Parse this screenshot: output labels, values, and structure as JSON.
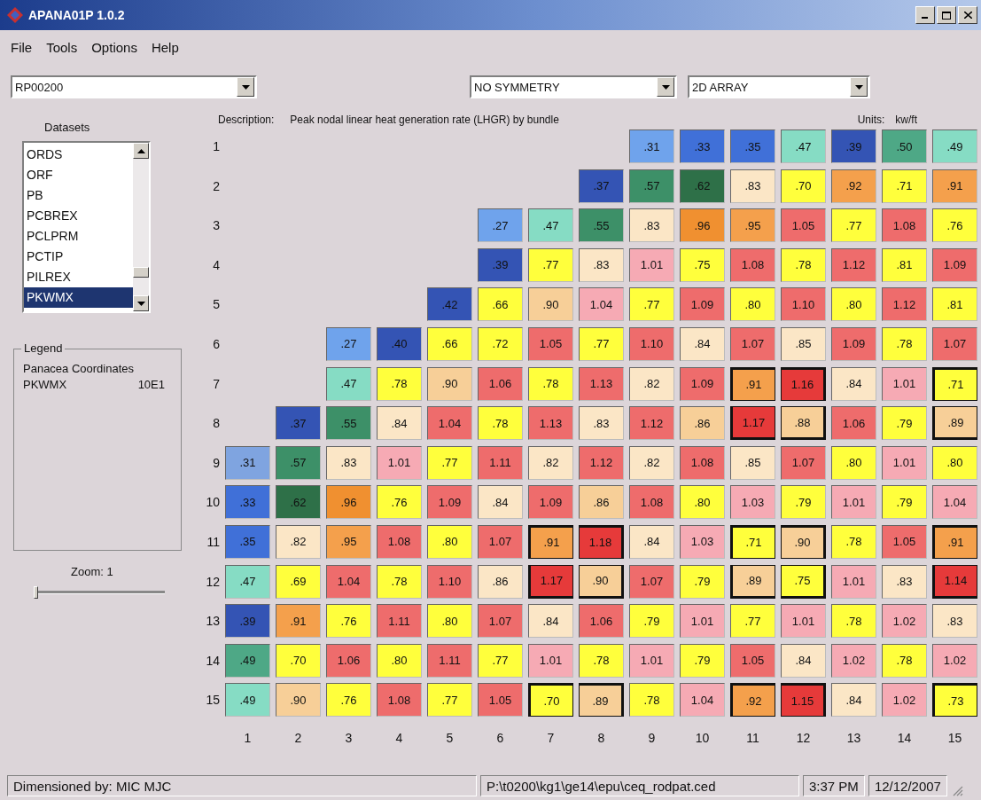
{
  "window": {
    "title": "APANA01P 1.0.2"
  },
  "menu": [
    {
      "label": "File"
    },
    {
      "label": "Tools"
    },
    {
      "label": "Options"
    },
    {
      "label": "Help"
    }
  ],
  "dataset_select": {
    "value": "RP00200"
  },
  "symmetry_select": {
    "value": "NO SYMMETRY"
  },
  "view_select": {
    "value": "2D ARRAY"
  },
  "datasets": {
    "label": "Datasets",
    "items": [
      {
        "label": "ORDS",
        "selected": false
      },
      {
        "label": "ORF",
        "selected": false
      },
      {
        "label": "PB",
        "selected": false
      },
      {
        "label": "PCBREX",
        "selected": false
      },
      {
        "label": "PCLPRM",
        "selected": false
      },
      {
        "label": "PCTIP",
        "selected": false
      },
      {
        "label": "PILREX",
        "selected": false
      },
      {
        "label": "PKWMX",
        "selected": true
      }
    ]
  },
  "legend": {
    "title": "Legend",
    "heading": "Panacea Coordinates",
    "name": "PKWMX",
    "value": "10E1"
  },
  "zoom": {
    "label": "Zoom:  1",
    "level": 0
  },
  "description": {
    "label": "Description:",
    "text": "Peak nodal linear heat generation rate (LHGR) by bundle",
    "units_label": "Units:",
    "units": "kw/ft"
  },
  "grid": {
    "rows": [
      {
        "label": "1",
        "cells": [
          "",
          "",
          "",
          "",
          "",
          "",
          "",
          "",
          {
            "value": ".31",
            "color": "#6fa3ec",
            "boxed": false
          },
          {
            "value": ".33",
            "color": "#4070d8",
            "boxed": false
          },
          {
            "value": ".35",
            "color": "#4070d8",
            "boxed": false
          },
          {
            "value": ".47",
            "color": "#86dcc4",
            "boxed": false
          },
          {
            "value": ".39",
            "color": "#3454b4",
            "boxed": false
          },
          {
            "value": ".50",
            "color": "#4ea886",
            "boxed": false
          },
          {
            "value": ".49",
            "color": "#86dcc4",
            "boxed": false
          }
        ]
      },
      {
        "label": "2",
        "cells": [
          "",
          "",
          "",
          "",
          "",
          "",
          "",
          {
            "value": ".37",
            "color": "#3454b4",
            "boxed": false
          },
          {
            "value": ".57",
            "color": "#3d9068",
            "boxed": false
          },
          {
            "value": ".62",
            "color": "#2e7048",
            "boxed": false
          },
          {
            "value": ".83",
            "color": "#fbe6c6",
            "boxed": false
          },
          {
            "value": ".70",
            "color": "#ffff3c",
            "boxed": false
          },
          {
            "value": ".92",
            "color": "#f4a04c",
            "boxed": false
          },
          {
            "value": ".71",
            "color": "#ffff3c",
            "boxed": false
          },
          {
            "value": ".91",
            "color": "#f4a04c",
            "boxed": false
          }
        ]
      },
      {
        "label": "3",
        "cells": [
          "",
          "",
          "",
          "",
          "",
          {
            "value": ".27",
            "color": "#6fa3ec",
            "boxed": false
          },
          {
            "value": ".47",
            "color": "#86dcc4",
            "boxed": false
          },
          {
            "value": ".55",
            "color": "#3d9068",
            "boxed": false
          },
          {
            "value": ".83",
            "color": "#fbe6c6",
            "boxed": false
          },
          {
            "value": ".96",
            "color": "#f09030",
            "boxed": false
          },
          {
            "value": ".95",
            "color": "#f4a04c",
            "boxed": false
          },
          {
            "value": "1.05",
            "color": "#ee6c6c",
            "boxed": false
          },
          {
            "value": ".77",
            "color": "#ffff3c",
            "boxed": false
          },
          {
            "value": "1.08",
            "color": "#ee6c6c",
            "boxed": false
          },
          {
            "value": ".76",
            "color": "#ffff3c",
            "boxed": false
          }
        ]
      },
      {
        "label": "4",
        "cells": [
          "",
          "",
          "",
          "",
          "",
          {
            "value": ".39",
            "color": "#3454b4",
            "boxed": false
          },
          {
            "value": ".77",
            "color": "#ffff3c",
            "boxed": false
          },
          {
            "value": ".83",
            "color": "#fbe6c6",
            "boxed": false
          },
          {
            "value": "1.01",
            "color": "#f6aab4",
            "boxed": false
          },
          {
            "value": ".75",
            "color": "#ffff3c",
            "boxed": false
          },
          {
            "value": "1.08",
            "color": "#ee6c6c",
            "boxed": false
          },
          {
            "value": ".78",
            "color": "#ffff3c",
            "boxed": false
          },
          {
            "value": "1.12",
            "color": "#ee6c6c",
            "boxed": false
          },
          {
            "value": ".81",
            "color": "#ffff3c",
            "boxed": false
          },
          {
            "value": "1.09",
            "color": "#ee6c6c",
            "boxed": false
          }
        ]
      },
      {
        "label": "5",
        "cells": [
          "",
          "",
          "",
          "",
          {
            "value": ".42",
            "color": "#3454b4",
            "boxed": false
          },
          {
            "value": ".66",
            "color": "#ffff3c",
            "boxed": false
          },
          {
            "value": ".90",
            "color": "#f7cf98",
            "boxed": false
          },
          {
            "value": "1.04",
            "color": "#f6aab4",
            "boxed": false
          },
          {
            "value": ".77",
            "color": "#ffff3c",
            "boxed": false
          },
          {
            "value": "1.09",
            "color": "#ee6c6c",
            "boxed": false
          },
          {
            "value": ".80",
            "color": "#ffff3c",
            "boxed": false
          },
          {
            "value": "1.10",
            "color": "#ee6c6c",
            "boxed": false
          },
          {
            "value": ".80",
            "color": "#ffff3c",
            "boxed": false
          },
          {
            "value": "1.12",
            "color": "#ee6c6c",
            "boxed": false
          },
          {
            "value": ".81",
            "color": "#ffff3c",
            "boxed": false
          }
        ]
      },
      {
        "label": "6",
        "cells": [
          "",
          "",
          {
            "value": ".27",
            "color": "#6fa3ec",
            "boxed": false
          },
          {
            "value": ".40",
            "color": "#3454b4",
            "boxed": false
          },
          {
            "value": ".66",
            "color": "#ffff3c",
            "boxed": false
          },
          {
            "value": ".72",
            "color": "#ffff3c",
            "boxed": false
          },
          {
            "value": "1.05",
            "color": "#ee6c6c",
            "boxed": false
          },
          {
            "value": ".77",
            "color": "#ffff3c",
            "boxed": false
          },
          {
            "value": "1.10",
            "color": "#ee6c6c",
            "boxed": false
          },
          {
            "value": ".84",
            "color": "#fbe6c6",
            "boxed": false
          },
          {
            "value": "1.07",
            "color": "#ee6c6c",
            "boxed": false
          },
          {
            "value": ".85",
            "color": "#fbe6c6",
            "boxed": false
          },
          {
            "value": "1.09",
            "color": "#ee6c6c",
            "boxed": false
          },
          {
            "value": ".78",
            "color": "#ffff3c",
            "boxed": false
          },
          {
            "value": "1.07",
            "color": "#ee6c6c",
            "boxed": false
          }
        ]
      },
      {
        "label": "7",
        "cells": [
          "",
          "",
          {
            "value": ".47",
            "color": "#86dcc4",
            "boxed": false
          },
          {
            "value": ".78",
            "color": "#ffff3c",
            "boxed": false
          },
          {
            "value": ".90",
            "color": "#f7cf98",
            "boxed": false
          },
          {
            "value": "1.06",
            "color": "#ee6c6c",
            "boxed": false
          },
          {
            "value": ".78",
            "color": "#ffff3c",
            "boxed": false
          },
          {
            "value": "1.13",
            "color": "#ee6c6c",
            "boxed": false
          },
          {
            "value": ".82",
            "color": "#fbe6c6",
            "boxed": false
          },
          {
            "value": "1.09",
            "color": "#ee6c6c",
            "boxed": false
          },
          {
            "value": ".91",
            "color": "#f4a04c",
            "boxed": true
          },
          {
            "value": "1.16",
            "color": "#e63a3a",
            "boxed": true
          },
          {
            "value": ".84",
            "color": "#fbe6c6",
            "boxed": false
          },
          {
            "value": "1.01",
            "color": "#f6aab4",
            "boxed": false
          },
          {
            "value": ".71",
            "color": "#ffff3c",
            "boxed": true
          }
        ]
      },
      {
        "label": "8",
        "cells": [
          "",
          {
            "value": ".37",
            "color": "#3454b4",
            "boxed": false
          },
          {
            "value": ".55",
            "color": "#3d9068",
            "boxed": false
          },
          {
            "value": ".84",
            "color": "#fbe6c6",
            "boxed": false
          },
          {
            "value": "1.04",
            "color": "#ee6c6c",
            "boxed": false
          },
          {
            "value": ".78",
            "color": "#ffff3c",
            "boxed": false
          },
          {
            "value": "1.13",
            "color": "#ee6c6c",
            "boxed": false
          },
          {
            "value": ".83",
            "color": "#fbe6c6",
            "boxed": false
          },
          {
            "value": "1.12",
            "color": "#ee6c6c",
            "boxed": false
          },
          {
            "value": ".86",
            "color": "#f7cf98",
            "boxed": false
          },
          {
            "value": "1.17",
            "color": "#e63a3a",
            "boxed": true
          },
          {
            "value": ".88",
            "color": "#f7cf98",
            "boxed": true
          },
          {
            "value": "1.06",
            "color": "#ee6c6c",
            "boxed": false
          },
          {
            "value": ".79",
            "color": "#ffff3c",
            "boxed": false
          },
          {
            "value": ".89",
            "color": "#f7cf98",
            "boxed": true
          }
        ]
      },
      {
        "label": "9",
        "cells": [
          {
            "value": ".31",
            "color": "#7fa4e0",
            "boxed": false
          },
          {
            "value": ".57",
            "color": "#3d9068",
            "boxed": false
          },
          {
            "value": ".83",
            "color": "#fbe6c6",
            "boxed": false
          },
          {
            "value": "1.01",
            "color": "#f6aab4",
            "boxed": false
          },
          {
            "value": ".77",
            "color": "#ffff3c",
            "boxed": false
          },
          {
            "value": "1.11",
            "color": "#ee6c6c",
            "boxed": false
          },
          {
            "value": ".82",
            "color": "#fbe6c6",
            "boxed": false
          },
          {
            "value": "1.12",
            "color": "#ee6c6c",
            "boxed": false
          },
          {
            "value": ".82",
            "color": "#fbe6c6",
            "boxed": false
          },
          {
            "value": "1.08",
            "color": "#ee6c6c",
            "boxed": false
          },
          {
            "value": ".85",
            "color": "#fbe6c6",
            "boxed": false
          },
          {
            "value": "1.07",
            "color": "#ee6c6c",
            "boxed": false
          },
          {
            "value": ".80",
            "color": "#ffff3c",
            "boxed": false
          },
          {
            "value": "1.01",
            "color": "#f6aab4",
            "boxed": false
          },
          {
            "value": ".80",
            "color": "#ffff3c",
            "boxed": false
          }
        ]
      },
      {
        "label": "10",
        "cells": [
          {
            "value": ".33",
            "color": "#4070d8",
            "boxed": false
          },
          {
            "value": ".62",
            "color": "#2e7048",
            "boxed": false
          },
          {
            "value": ".96",
            "color": "#f09030",
            "boxed": false
          },
          {
            "value": ".76",
            "color": "#ffff3c",
            "boxed": false
          },
          {
            "value": "1.09",
            "color": "#ee6c6c",
            "boxed": false
          },
          {
            "value": ".84",
            "color": "#fbe6c6",
            "boxed": false
          },
          {
            "value": "1.09",
            "color": "#ee6c6c",
            "boxed": false
          },
          {
            "value": ".86",
            "color": "#f7cf98",
            "boxed": false
          },
          {
            "value": "1.08",
            "color": "#ee6c6c",
            "boxed": false
          },
          {
            "value": ".80",
            "color": "#ffff3c",
            "boxed": false
          },
          {
            "value": "1.03",
            "color": "#f6aab4",
            "boxed": false
          },
          {
            "value": ".79",
            "color": "#ffff3c",
            "boxed": false
          },
          {
            "value": "1.01",
            "color": "#f6aab4",
            "boxed": false
          },
          {
            "value": ".79",
            "color": "#ffff3c",
            "boxed": false
          },
          {
            "value": "1.04",
            "color": "#f6aab4",
            "boxed": false
          }
        ]
      },
      {
        "label": "11",
        "cells": [
          {
            "value": ".35",
            "color": "#4070d8",
            "boxed": false
          },
          {
            "value": ".82",
            "color": "#fbe6c6",
            "boxed": false
          },
          {
            "value": ".95",
            "color": "#f4a04c",
            "boxed": false
          },
          {
            "value": "1.08",
            "color": "#ee6c6c",
            "boxed": false
          },
          {
            "value": ".80",
            "color": "#ffff3c",
            "boxed": false
          },
          {
            "value": "1.07",
            "color": "#ee6c6c",
            "boxed": false
          },
          {
            "value": ".91",
            "color": "#f4a04c",
            "boxed": true
          },
          {
            "value": "1.18",
            "color": "#e63a3a",
            "boxed": true
          },
          {
            "value": ".84",
            "color": "#fbe6c6",
            "boxed": false
          },
          {
            "value": "1.03",
            "color": "#f6aab4",
            "boxed": false
          },
          {
            "value": ".71",
            "color": "#ffff3c",
            "boxed": true
          },
          {
            "value": ".90",
            "color": "#f7cf98",
            "boxed": true
          },
          {
            "value": ".78",
            "color": "#ffff3c",
            "boxed": false
          },
          {
            "value": "1.05",
            "color": "#ee6c6c",
            "boxed": false
          },
          {
            "value": ".91",
            "color": "#f4a04c",
            "boxed": true
          }
        ]
      },
      {
        "label": "12",
        "cells": [
          {
            "value": ".47",
            "color": "#86dcc4",
            "boxed": false
          },
          {
            "value": ".69",
            "color": "#ffff3c",
            "boxed": false
          },
          {
            "value": "1.04",
            "color": "#ee6c6c",
            "boxed": false
          },
          {
            "value": ".78",
            "color": "#ffff3c",
            "boxed": false
          },
          {
            "value": "1.10",
            "color": "#ee6c6c",
            "boxed": false
          },
          {
            "value": ".86",
            "color": "#fbe6c6",
            "boxed": false
          },
          {
            "value": "1.17",
            "color": "#e63a3a",
            "boxed": true
          },
          {
            "value": ".90",
            "color": "#f7cf98",
            "boxed": true
          },
          {
            "value": "1.07",
            "color": "#ee6c6c",
            "boxed": false
          },
          {
            "value": ".79",
            "color": "#ffff3c",
            "boxed": false
          },
          {
            "value": ".89",
            "color": "#f7cf98",
            "boxed": true
          },
          {
            "value": ".75",
            "color": "#ffff3c",
            "boxed": true
          },
          {
            "value": "1.01",
            "color": "#f6aab4",
            "boxed": false
          },
          {
            "value": ".83",
            "color": "#fbe6c6",
            "boxed": false
          },
          {
            "value": "1.14",
            "color": "#e63a3a",
            "boxed": true
          }
        ]
      },
      {
        "label": "13",
        "cells": [
          {
            "value": ".39",
            "color": "#3454b4",
            "boxed": false
          },
          {
            "value": ".91",
            "color": "#f4a04c",
            "boxed": false
          },
          {
            "value": ".76",
            "color": "#ffff3c",
            "boxed": false
          },
          {
            "value": "1.11",
            "color": "#ee6c6c",
            "boxed": false
          },
          {
            "value": ".80",
            "color": "#ffff3c",
            "boxed": false
          },
          {
            "value": "1.07",
            "color": "#ee6c6c",
            "boxed": false
          },
          {
            "value": ".84",
            "color": "#fbe6c6",
            "boxed": false
          },
          {
            "value": "1.06",
            "color": "#ee6c6c",
            "boxed": false
          },
          {
            "value": ".79",
            "color": "#ffff3c",
            "boxed": false
          },
          {
            "value": "1.01",
            "color": "#f6aab4",
            "boxed": false
          },
          {
            "value": ".77",
            "color": "#ffff3c",
            "boxed": false
          },
          {
            "value": "1.01",
            "color": "#f6aab4",
            "boxed": false
          },
          {
            "value": ".78",
            "color": "#ffff3c",
            "boxed": false
          },
          {
            "value": "1.02",
            "color": "#f6aab4",
            "boxed": false
          },
          {
            "value": ".83",
            "color": "#fbe6c6",
            "boxed": false
          }
        ]
      },
      {
        "label": "14",
        "cells": [
          {
            "value": ".49",
            "color": "#4ea886",
            "boxed": false
          },
          {
            "value": ".70",
            "color": "#ffff3c",
            "boxed": false
          },
          {
            "value": "1.06",
            "color": "#ee6c6c",
            "boxed": false
          },
          {
            "value": ".80",
            "color": "#ffff3c",
            "boxed": false
          },
          {
            "value": "1.11",
            "color": "#ee6c6c",
            "boxed": false
          },
          {
            "value": ".77",
            "color": "#ffff3c",
            "boxed": false
          },
          {
            "value": "1.01",
            "color": "#f6aab4",
            "boxed": false
          },
          {
            "value": ".78",
            "color": "#ffff3c",
            "boxed": false
          },
          {
            "value": "1.01",
            "color": "#f6aab4",
            "boxed": false
          },
          {
            "value": ".79",
            "color": "#ffff3c",
            "boxed": false
          },
          {
            "value": "1.05",
            "color": "#ee6c6c",
            "boxed": false
          },
          {
            "value": ".84",
            "color": "#fbe6c6",
            "boxed": false
          },
          {
            "value": "1.02",
            "color": "#f6aab4",
            "boxed": false
          },
          {
            "value": ".78",
            "color": "#ffff3c",
            "boxed": false
          },
          {
            "value": "1.02",
            "color": "#f6aab4",
            "boxed": false
          }
        ]
      },
      {
        "label": "15",
        "cells": [
          {
            "value": ".49",
            "color": "#86dcc4",
            "boxed": false
          },
          {
            "value": ".90",
            "color": "#f7cf98",
            "boxed": false
          },
          {
            "value": ".76",
            "color": "#ffff3c",
            "boxed": false
          },
          {
            "value": "1.08",
            "color": "#ee6c6c",
            "boxed": false
          },
          {
            "value": ".77",
            "color": "#ffff3c",
            "boxed": false
          },
          {
            "value": "1.05",
            "color": "#ee6c6c",
            "boxed": false
          },
          {
            "value": ".70",
            "color": "#ffff3c",
            "boxed": true
          },
          {
            "value": ".89",
            "color": "#f7cf98",
            "boxed": true
          },
          {
            "value": ".78",
            "color": "#ffff3c",
            "boxed": false
          },
          {
            "value": "1.04",
            "color": "#f6aab4",
            "boxed": false
          },
          {
            "value": ".92",
            "color": "#f4a04c",
            "boxed": true
          },
          {
            "value": "1.15",
            "color": "#e63a3a",
            "boxed": true
          },
          {
            "value": ".84",
            "color": "#fbe6c6",
            "boxed": false
          },
          {
            "value": "1.02",
            "color": "#f6aab4",
            "boxed": false
          },
          {
            "value": ".73",
            "color": "#ffff3c",
            "boxed": true
          }
        ]
      }
    ]
  },
  "column_axis": {
    "labels": [
      "1",
      "2",
      "3",
      "4",
      "5",
      "6",
      "7",
      "8",
      "9",
      "10",
      "11",
      "12",
      "13",
      "14",
      "15"
    ]
  },
  "status_bar": {
    "dimensioned": "Dimensioned by:  MIC MJC",
    "path": "P:\\t0200\\kg1\\ge14\\epu\\ceq_rodpat.ced",
    "time": "3:37 PM",
    "date": "12/12/2007"
  }
}
